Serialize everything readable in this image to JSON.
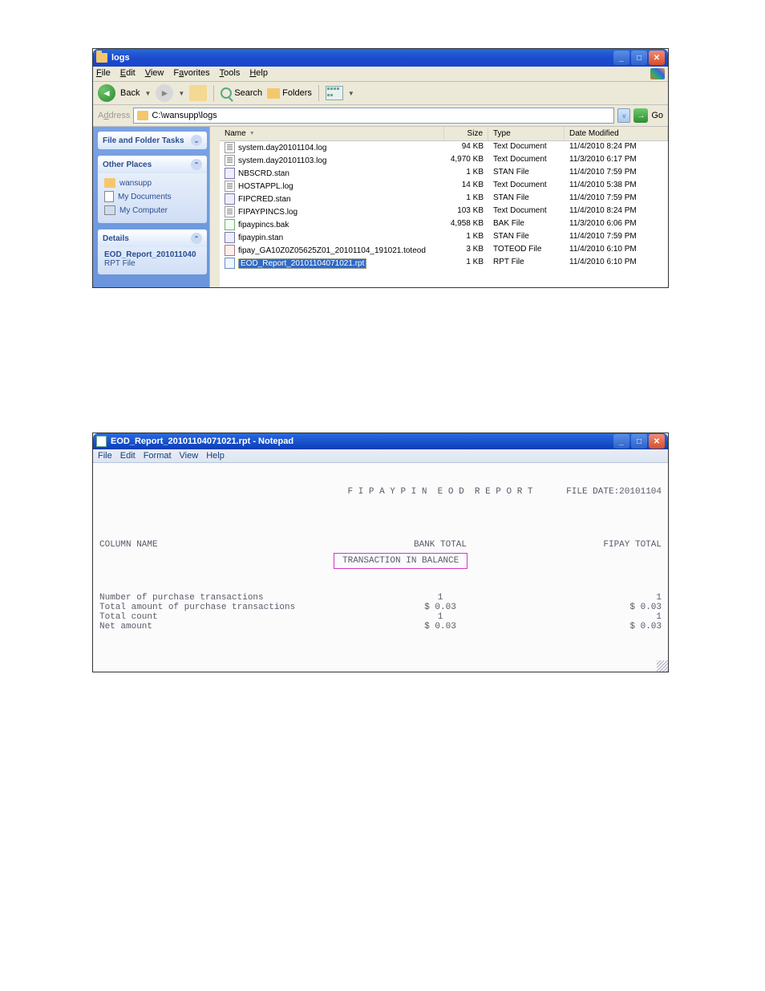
{
  "explorer": {
    "title": "logs",
    "menu": {
      "file": "File",
      "edit": "Edit",
      "view": "View",
      "favorites": "Favorites",
      "tools": "Tools",
      "help": "Help"
    },
    "toolbar": {
      "back": "Back",
      "search": "Search",
      "folders": "Folders"
    },
    "address": {
      "label": "Address",
      "path": "C:\\wansupp\\logs",
      "go": "Go"
    },
    "sidebar": {
      "tasks_title": "File and Folder Tasks",
      "places_title": "Other Places",
      "places": [
        {
          "label": "wansupp"
        },
        {
          "label": "My Documents"
        },
        {
          "label": "My Computer"
        }
      ],
      "details_title": "Details",
      "details_line1": "EOD_Report_201011040",
      "details_line2": "RPT File"
    },
    "columns": {
      "name": "Name",
      "size": "Size",
      "type": "Type",
      "date": "Date Modified"
    },
    "files": [
      {
        "name": "system.day20101104.log",
        "size": "94 KB",
        "type": "Text Document",
        "date": "11/4/2010 8:24 PM",
        "ico": "doc"
      },
      {
        "name": "system.day20101103.log",
        "size": "4,970 KB",
        "type": "Text Document",
        "date": "11/3/2010 6:17 PM",
        "ico": "doc"
      },
      {
        "name": "NBSCRD.stan",
        "size": "1 KB",
        "type": "STAN File",
        "date": "11/4/2010 7:59 PM",
        "ico": "stan"
      },
      {
        "name": "HOSTAPPL.log",
        "size": "14 KB",
        "type": "Text Document",
        "date": "11/4/2010 5:38 PM",
        "ico": "doc"
      },
      {
        "name": "FIPCRED.stan",
        "size": "1 KB",
        "type": "STAN File",
        "date": "11/4/2010 7:59 PM",
        "ico": "stan"
      },
      {
        "name": "FIPAYPINCS.log",
        "size": "103 KB",
        "type": "Text Document",
        "date": "11/4/2010 8:24 PM",
        "ico": "doc"
      },
      {
        "name": "fipaypincs.bak",
        "size": "4,958 KB",
        "type": "BAK File",
        "date": "11/3/2010 6:06 PM",
        "ico": "bak"
      },
      {
        "name": "fipaypin.stan",
        "size": "1 KB",
        "type": "STAN File",
        "date": "11/4/2010 7:59 PM",
        "ico": "stan"
      },
      {
        "name": "fipay_GA10Z0Z05625Z01_20101104_191021.toteod",
        "size": "3 KB",
        "type": "TOTEOD File",
        "date": "11/4/2010 6:10 PM",
        "ico": "eod"
      },
      {
        "name": "EOD_Report_20101104071021.rpt",
        "size": "1 KB",
        "type": "RPT File",
        "date": "11/4/2010 6:10 PM",
        "ico": "rpt",
        "selected": true
      }
    ]
  },
  "notepad": {
    "title": "EOD_Report_20101104071021.rpt - Notepad",
    "menu": {
      "file": "File",
      "edit": "Edit",
      "format": "Format",
      "view": "View",
      "help": "Help"
    },
    "report": {
      "header_center": "F I P A Y P I N  E O D  R E P O R T",
      "header_right": "FILE DATE:20101104",
      "col_header_left": "COLUMN NAME",
      "col_header_center": "BANK TOTAL",
      "col_header_right": "FIPAY TOTAL",
      "rows": [
        {
          "label": "Number of purchase transactions",
          "bank": "1",
          "fipay": "1"
        },
        {
          "label": "Total amount of purchase transactions",
          "bank": "$ 0.03",
          "fipay": "$ 0.03"
        },
        {
          "label": "Total count",
          "bank": "1",
          "fipay": "1"
        },
        {
          "label": "Net amount",
          "bank": "$ 0.03",
          "fipay": "$ 0.03"
        }
      ],
      "balance": "TRANSACTION IN BALANCE"
    }
  }
}
